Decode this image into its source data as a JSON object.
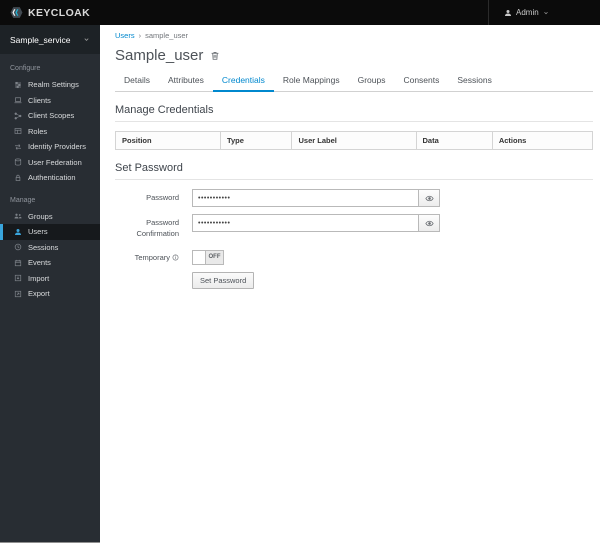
{
  "colors": {
    "accent_blue": "#0088ce",
    "active_nav_border": "#39a5dc",
    "header_bg": "#0b0b0b",
    "sidebar_bg": "#282d33",
    "logo_cyan": "#1fb5d8"
  },
  "header": {
    "brand": "KEYCLOAK",
    "user_menu": {
      "label": "Admin",
      "icon": "user-icon"
    }
  },
  "sidebar": {
    "realm_selector": {
      "value": "Sample_service",
      "icon": "chevron-down-icon"
    },
    "sections": [
      {
        "label": "Configure",
        "items": [
          {
            "label": "Realm Settings",
            "icon": "sliders-icon",
            "active": false
          },
          {
            "label": "Clients",
            "icon": "clients-icon",
            "active": false
          },
          {
            "label": "Client Scopes",
            "icon": "client-scopes-icon",
            "active": false
          },
          {
            "label": "Roles",
            "icon": "roles-icon",
            "active": false
          },
          {
            "label": "Identity Providers",
            "icon": "identity-providers-icon",
            "active": false
          },
          {
            "label": "User Federation",
            "icon": "database-icon",
            "active": false
          },
          {
            "label": "Authentication",
            "icon": "lock-icon",
            "active": false
          }
        ]
      },
      {
        "label": "Manage",
        "items": [
          {
            "label": "Groups",
            "icon": "groups-icon",
            "active": false
          },
          {
            "label": "Users",
            "icon": "user-icon",
            "active": true
          },
          {
            "label": "Sessions",
            "icon": "clock-icon",
            "active": false
          },
          {
            "label": "Events",
            "icon": "calendar-icon",
            "active": false
          },
          {
            "label": "Import",
            "icon": "import-icon",
            "active": false
          },
          {
            "label": "Export",
            "icon": "export-icon",
            "active": false
          }
        ]
      }
    ]
  },
  "breadcrumb": {
    "separator": "›",
    "items": [
      {
        "label": "Users",
        "link": true
      },
      {
        "label": "sample_user",
        "link": false
      }
    ]
  },
  "page": {
    "title": "Sample_user",
    "delete_icon": "trash-icon"
  },
  "tabs": [
    {
      "label": "Details",
      "active": false
    },
    {
      "label": "Attributes",
      "active": false
    },
    {
      "label": "Credentials",
      "active": true
    },
    {
      "label": "Role Mappings",
      "active": false
    },
    {
      "label": "Groups",
      "active": false
    },
    {
      "label": "Consents",
      "active": false
    },
    {
      "label": "Sessions",
      "active": false
    }
  ],
  "manage_credentials": {
    "heading": "Manage Credentials",
    "table": {
      "headers": [
        "Position",
        "Type",
        "User Label",
        "Data",
        "Actions"
      ],
      "rows": []
    }
  },
  "set_password": {
    "heading": "Set Password",
    "fields": {
      "password": {
        "label": "Password",
        "masked_value": "•••••••••••",
        "reveal_icon": "eye-icon"
      },
      "password_confirmation": {
        "label": "Password Confirmation",
        "masked_value": "•••••••••••",
        "reveal_icon": "eye-icon"
      },
      "temporary": {
        "label": "Temporary",
        "info_icon": "info-icon",
        "toggle_state": "OFF"
      }
    },
    "submit_label": "Set Password"
  }
}
